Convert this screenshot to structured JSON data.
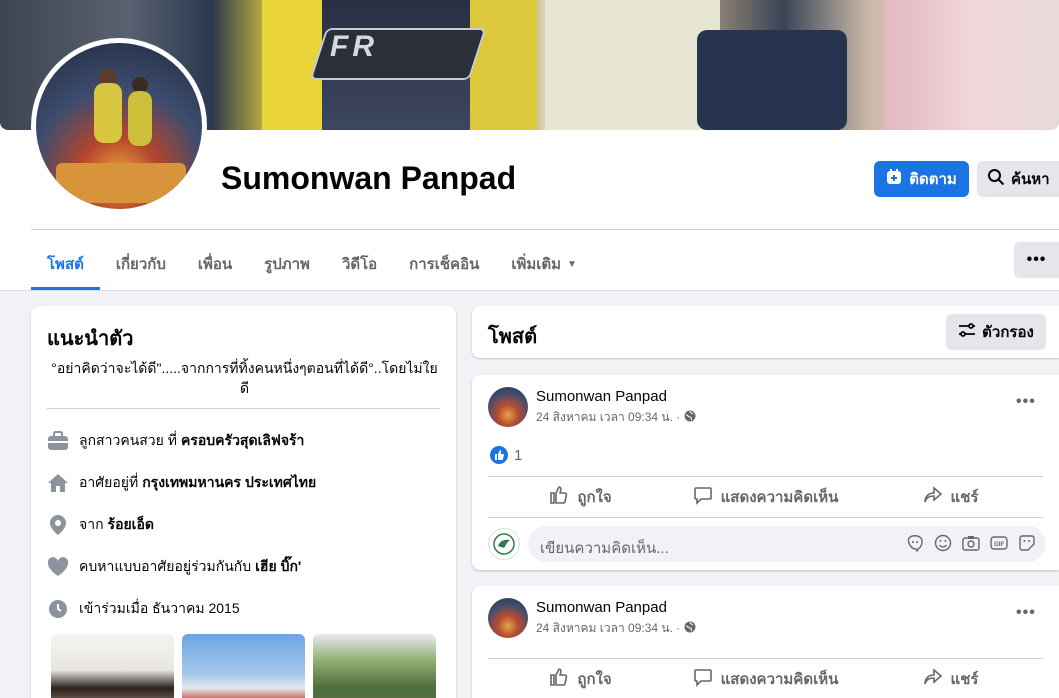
{
  "profile": {
    "name": "Sumonwan Panpad",
    "follow_label": "ติดตาม",
    "search_label": "ค้นหา"
  },
  "tabs": [
    {
      "label": "โพสต์"
    },
    {
      "label": "เกี่ยวกับ"
    },
    {
      "label": "เพื่อน"
    },
    {
      "label": "รูปภาพ"
    },
    {
      "label": "วิดีโอ"
    },
    {
      "label": "การเช็คอิน"
    },
    {
      "label": "เพิ่มเติม"
    }
  ],
  "more_label": "•••",
  "intro": {
    "title": "แนะนำตัว",
    "bio": "°อย่าคิดว่าจะได้ดี\".....จากการที่ทิ้งคนหนึ่งๆตอนที่ได้ดี°..โดยไม่ใยดี",
    "work": {
      "prefix": "ลูกสาวคนสวย ที่",
      "value": "ครอบครัวสุดเลิฟจร้า"
    },
    "lives": {
      "prefix": "อาศัยอยู่ที่",
      "value": "กรุงเทพมหานคร ประเทศไทย"
    },
    "from": {
      "prefix": "จาก",
      "value": "ร้อยเอ็ด"
    },
    "relationship": {
      "prefix": "คบหาแบบอาศัยอยู่ร่วมกันกับ",
      "value": "เฮีย บิ๊ก'"
    },
    "joined": "เข้าร่วมเมื่อ ธันวาคม 2015"
  },
  "posts_header": {
    "title": "โพสต์",
    "filter_label": "ตัวกรอง"
  },
  "posts": [
    {
      "author": "Sumonwan Panpad",
      "time": "24 สิงหาคม เวลา 09:34 น. ·",
      "reaction_count": "1",
      "like_label": "ถูกใจ",
      "comment_label": "แสดงความคิดเห็น",
      "share_label": "แชร์",
      "comment_placeholder": "เขียนความคิดเห็น..."
    },
    {
      "author": "Sumonwan Panpad",
      "time": "24 สิงหาคม เวลา 09:34 น. ·",
      "like_label": "ถูกใจ",
      "comment_label": "แสดงความคิดเห็น",
      "share_label": "แชร์"
    }
  ],
  "colors": {
    "accent": "#1b74e4",
    "background": "#f0f2f5",
    "secondary_text": "#65676b"
  },
  "cover_logo_text": "FR"
}
